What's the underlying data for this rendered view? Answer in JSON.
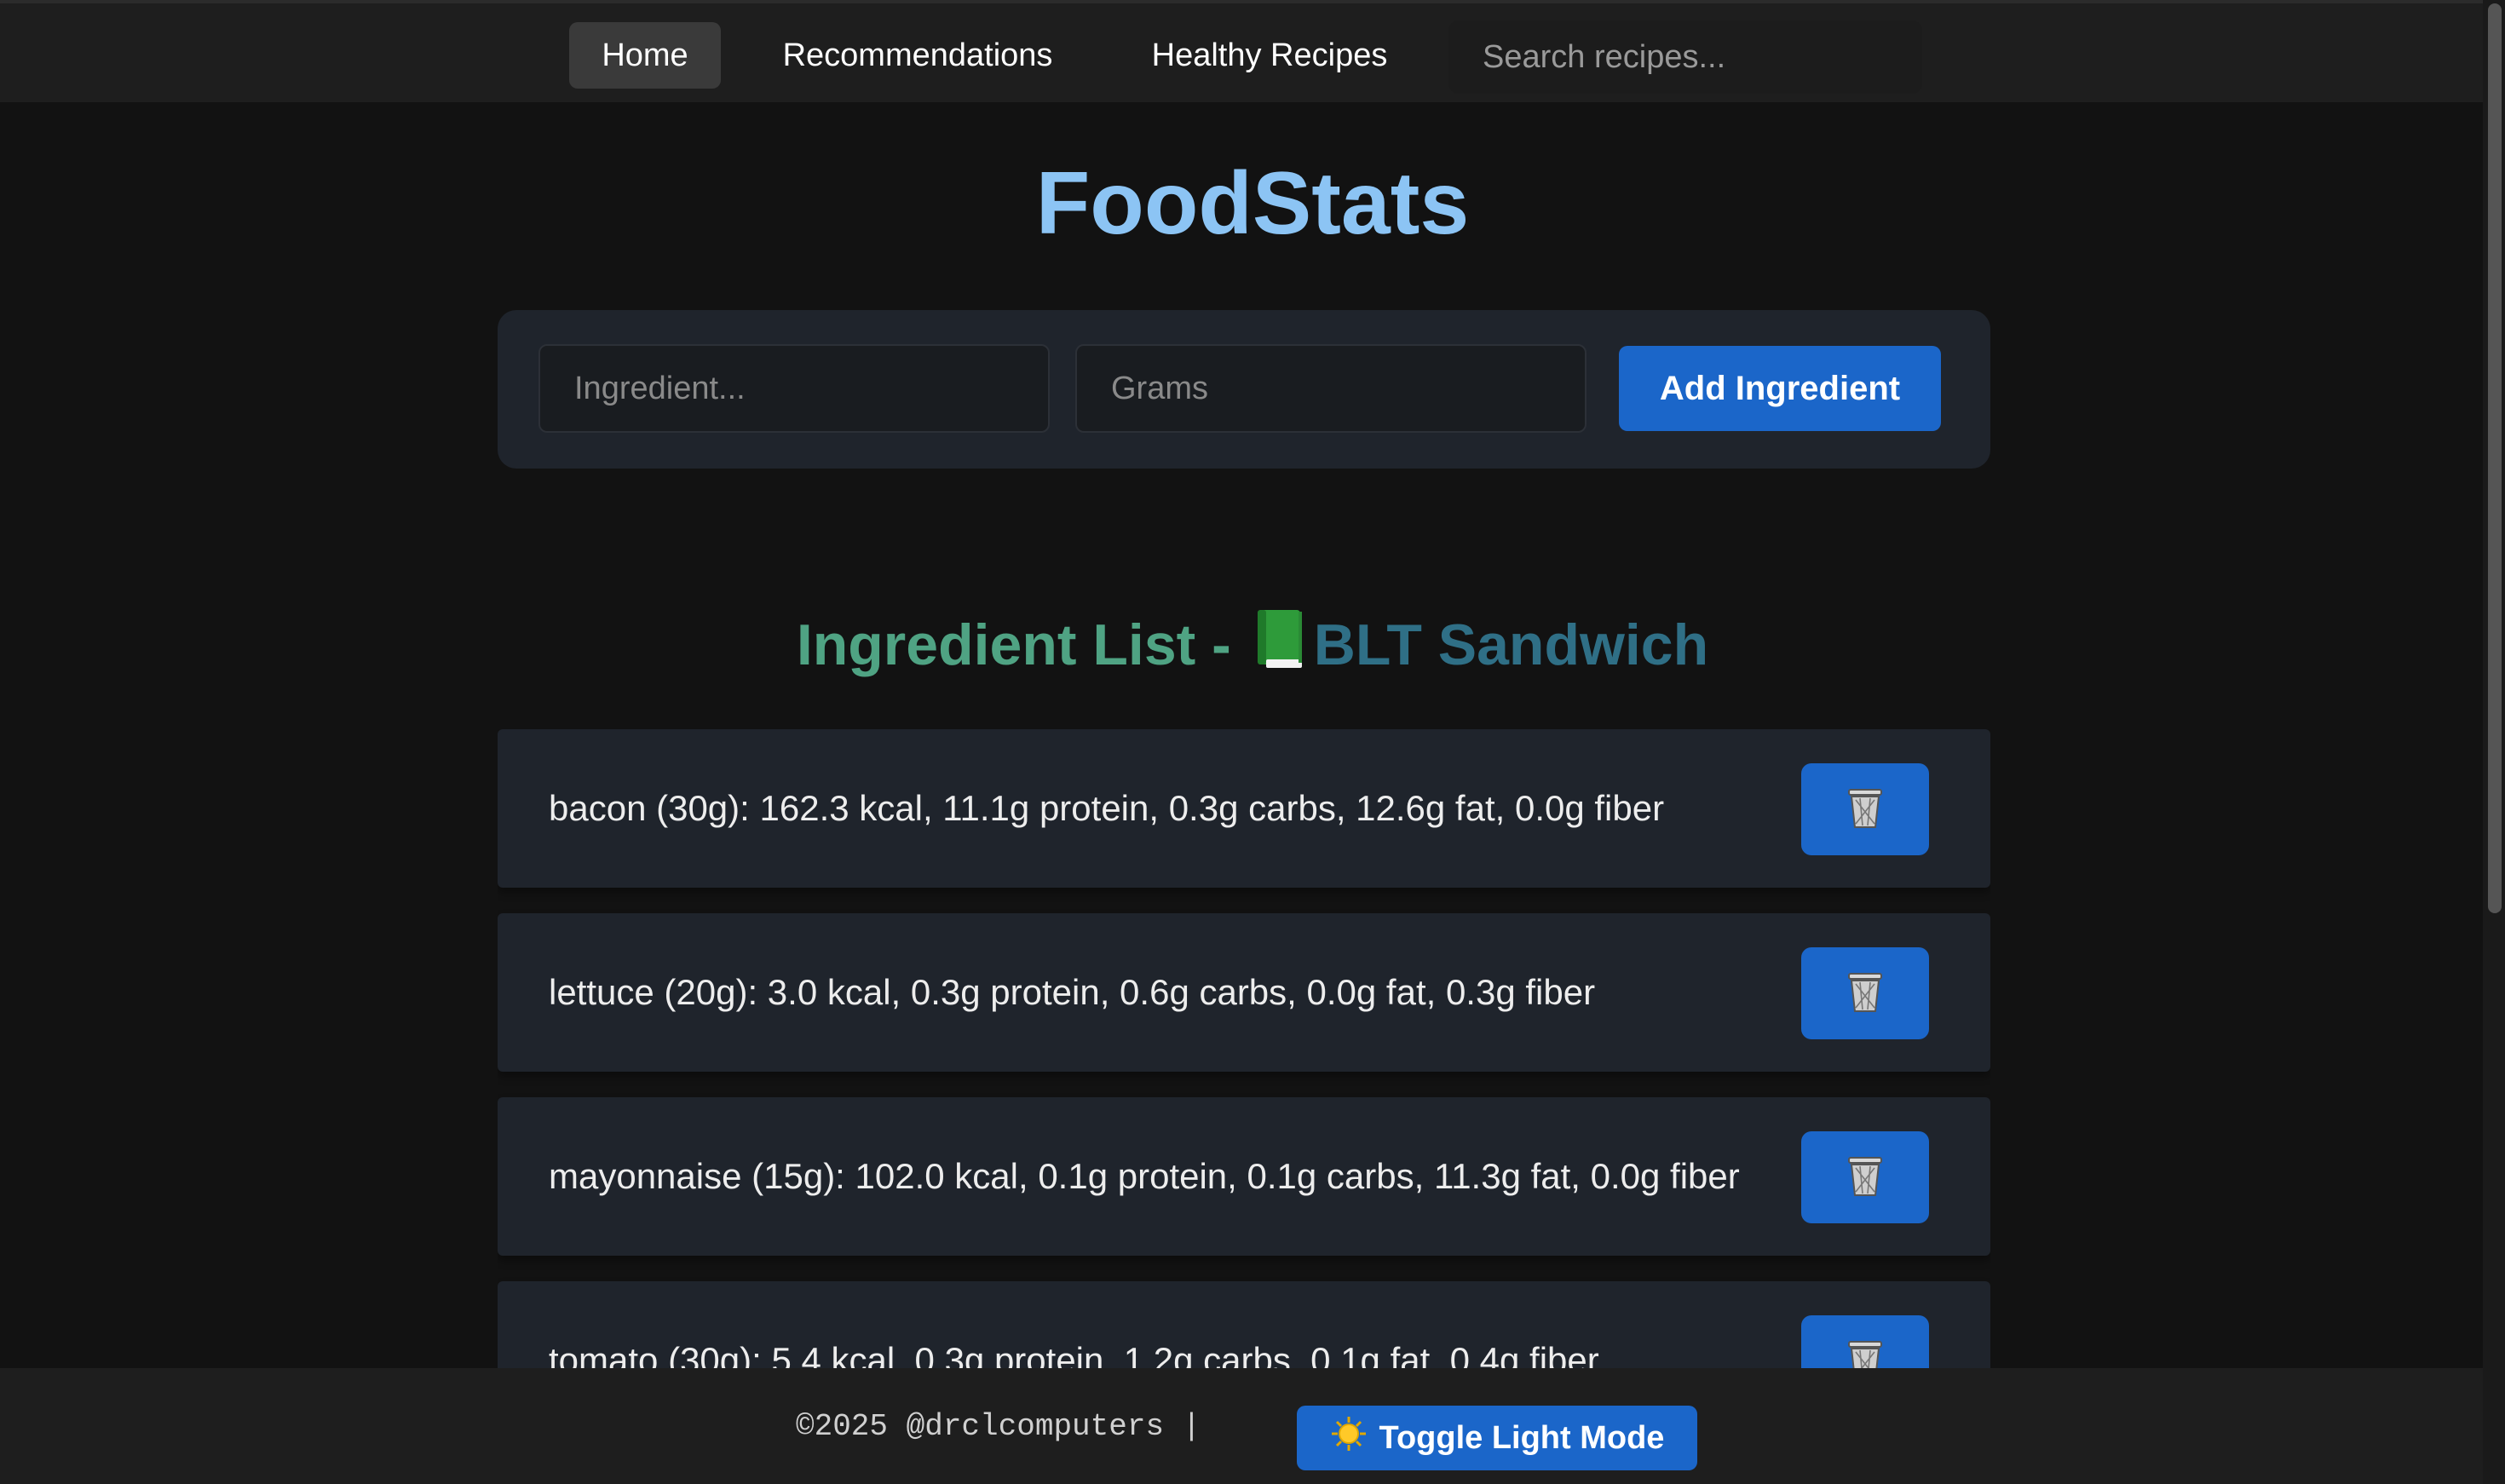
{
  "nav": {
    "home": "Home",
    "recommendations": "Recommendations",
    "healthy_recipes": "Healthy Recipes",
    "search_placeholder": "Search recipes..."
  },
  "title": "FoodStats",
  "form": {
    "ingredient_placeholder": "Ingredient...",
    "grams_placeholder": "Grams",
    "add_label": "Add Ingredient"
  },
  "list": {
    "heading_prefix": "Ingredient List - ",
    "heading_icon": "green-book-icon",
    "recipe_name": "BLT Sandwich",
    "items": [
      {
        "text": "bacon (30g): 162.3 kcal, 11.1g protein, 0.3g carbs, 12.6g fat, 0.0g fiber"
      },
      {
        "text": "lettuce (20g): 3.0 kcal, 0.3g protein, 0.6g carbs, 0.0g fat, 0.3g fiber"
      },
      {
        "text": "mayonnaise (15g): 102.0 kcal, 0.1g protein, 0.1g carbs, 11.3g fat, 0.0g fiber"
      },
      {
        "text": "tomato (30g): 5.4 kcal, 0.3g protein, 1.2g carbs, 0.1g fat, 0.4g fiber"
      }
    ],
    "delete_icon": "wastebasket-icon"
  },
  "footer": {
    "copyright": "©2025 @drclcomputers |",
    "toggle_label": "Toggle Light Mode",
    "toggle_icon": "sun-icon"
  },
  "colors": {
    "background": "#121212",
    "panel": "#1f242c",
    "accent": "#1b66c9",
    "title": "#8cc4f4",
    "heading_green": "#4fa383",
    "heading_teal": "#2f6f86"
  }
}
